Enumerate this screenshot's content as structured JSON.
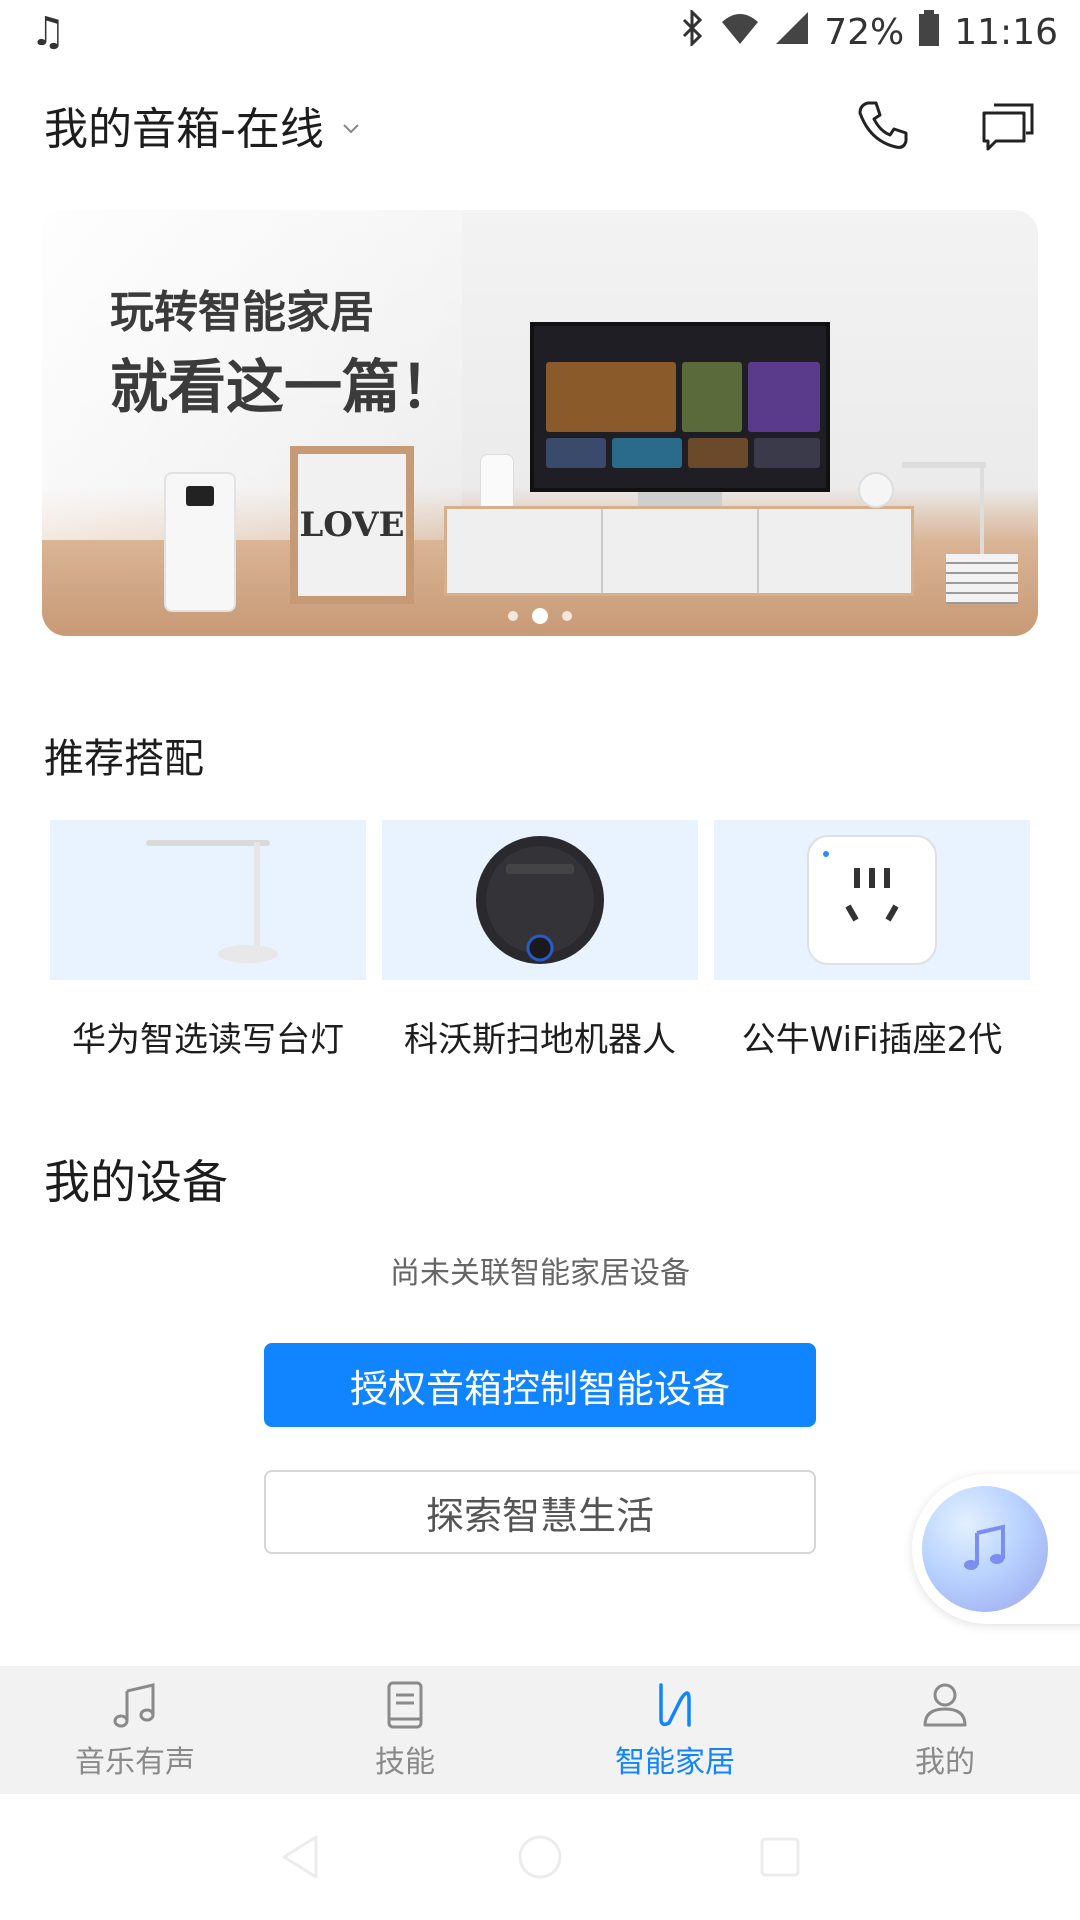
{
  "status_bar": {
    "battery": "72%",
    "time": "11:16"
  },
  "header": {
    "title": "我的音箱-在线"
  },
  "banner": {
    "line1": "玩转智能家居",
    "line2": "就看这一篇！",
    "frame_text": "LOVE",
    "slide_count": 3,
    "active_slide": 1
  },
  "recommend": {
    "title": "推荐搭配",
    "items": [
      {
        "label": "华为智选读写台灯",
        "icon": "desk-lamp"
      },
      {
        "label": "科沃斯扫地机器人",
        "icon": "robot-vacuum"
      },
      {
        "label": "公牛WiFi插座2代",
        "icon": "smart-plug"
      }
    ]
  },
  "devices": {
    "title": "我的设备",
    "empty_text": "尚未关联智能家居设备",
    "primary_button": "授权音箱控制智能设备",
    "secondary_button": "探索智慧生活"
  },
  "tabs": [
    {
      "label": "音乐有声",
      "icon": "music-note"
    },
    {
      "label": "技能",
      "icon": "book"
    },
    {
      "label": "智能家居",
      "icon": "smart-home",
      "active": true
    },
    {
      "label": "我的",
      "icon": "person"
    }
  ],
  "colors": {
    "accent": "#1184ff",
    "tab_inactive": "#8a8a8a",
    "card_bg": "#e9f3ff"
  }
}
